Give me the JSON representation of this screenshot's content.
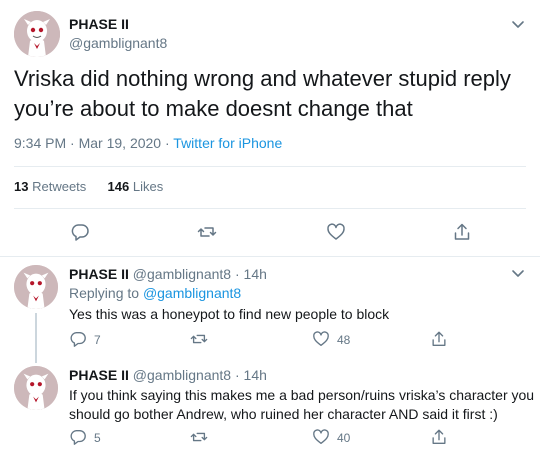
{
  "main_tweet": {
    "display_name": "PHASE II",
    "handle": "@gamblignant8",
    "text_line1": "Vriska did nothing wrong and whatever stupid reply",
    "text_line2": "you’re about to make doesnt change that",
    "time": "9:34 PM",
    "dot": "·",
    "date": "Mar 19, 2020",
    "source": "Twitter for iPhone",
    "retweets_count": "13",
    "retweets_label": "Retweets",
    "likes_count": "146",
    "likes_label": "Likes"
  },
  "replies": [
    {
      "display_name": "PHASE II",
      "handle": "@gamblignant8",
      "time": "14h",
      "dot": "·",
      "replying_prefix": "Replying to",
      "replying_handle": "@gamblignant8",
      "text_line1": "Yes this was a honeypot to find new people to block",
      "text_line2": "",
      "reply_count": "7",
      "like_count": "48"
    },
    {
      "display_name": "PHASE II",
      "handle": "@gamblignant8",
      "time": "14h",
      "dot": "·",
      "text_line1": "If you think saying this makes me a bad person/ruins vriska’s character you",
      "text_line2": "should go bother Andrew, who ruined her character AND said it first :)",
      "reply_count": "5",
      "like_count": "40"
    }
  ],
  "icons": {
    "reply": "comment-bubble-icon",
    "retweet": "retweet-icon",
    "like": "heart-icon",
    "share": "share-upload-icon",
    "menu": "chevron-down-icon"
  },
  "colors": {
    "link": "#1b95e0",
    "muted": "#657786",
    "text": "#14171a"
  }
}
